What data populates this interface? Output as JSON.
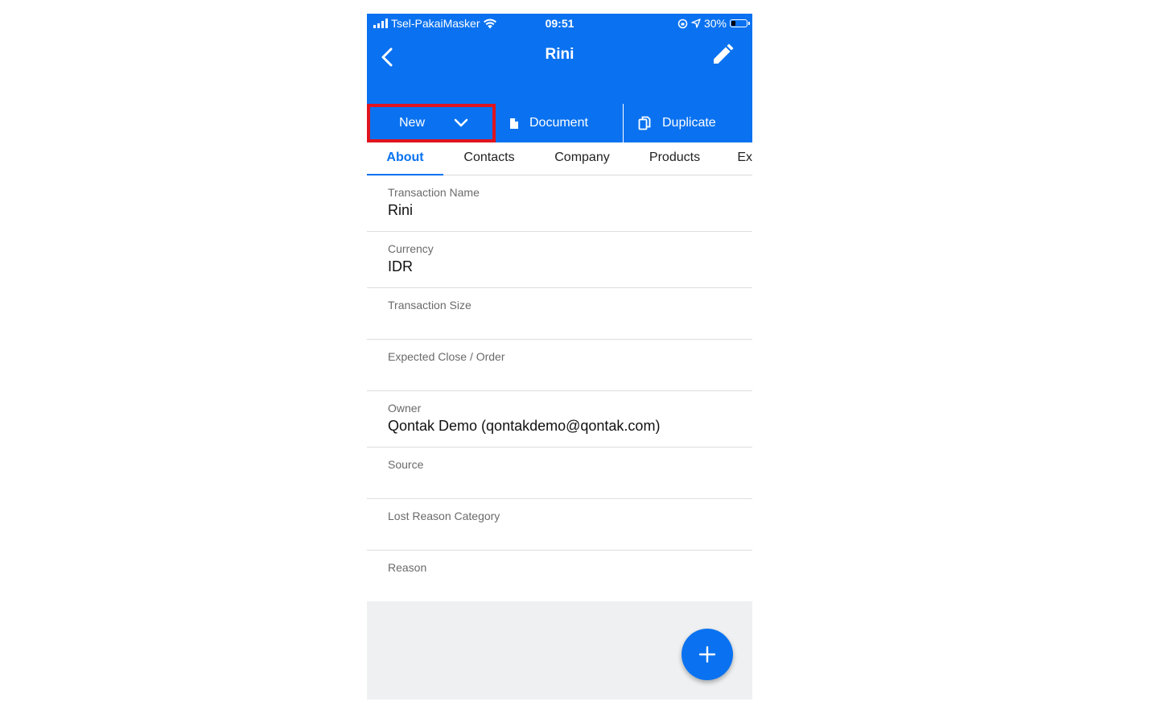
{
  "status_bar": {
    "carrier": "Tsel-PakaiMasker",
    "time": "09:51",
    "battery": "30%",
    "battery_level": 0.3
  },
  "header": {
    "title": "Rini"
  },
  "actions": {
    "new_label": "New",
    "document_label": "Document",
    "duplicate_label": "Duplicate"
  },
  "tabs": [
    "About",
    "Contacts",
    "Company",
    "Products",
    "Ex"
  ],
  "fields": [
    {
      "label": "Transaction Name",
      "value": "Rini"
    },
    {
      "label": "Currency",
      "value": "IDR"
    },
    {
      "label": "Transaction Size",
      "value": ""
    },
    {
      "label": "Expected Close / Order",
      "value": ""
    },
    {
      "label": "Owner",
      "value": "Qontak Demo (qontakdemo@qontak.com)"
    },
    {
      "label": "Source",
      "value": ""
    },
    {
      "label": "Lost Reason Category",
      "value": ""
    },
    {
      "label": "Reason",
      "value": ""
    }
  ],
  "colors": {
    "primary": "#0a72f0",
    "highlight": "#e0141e"
  }
}
